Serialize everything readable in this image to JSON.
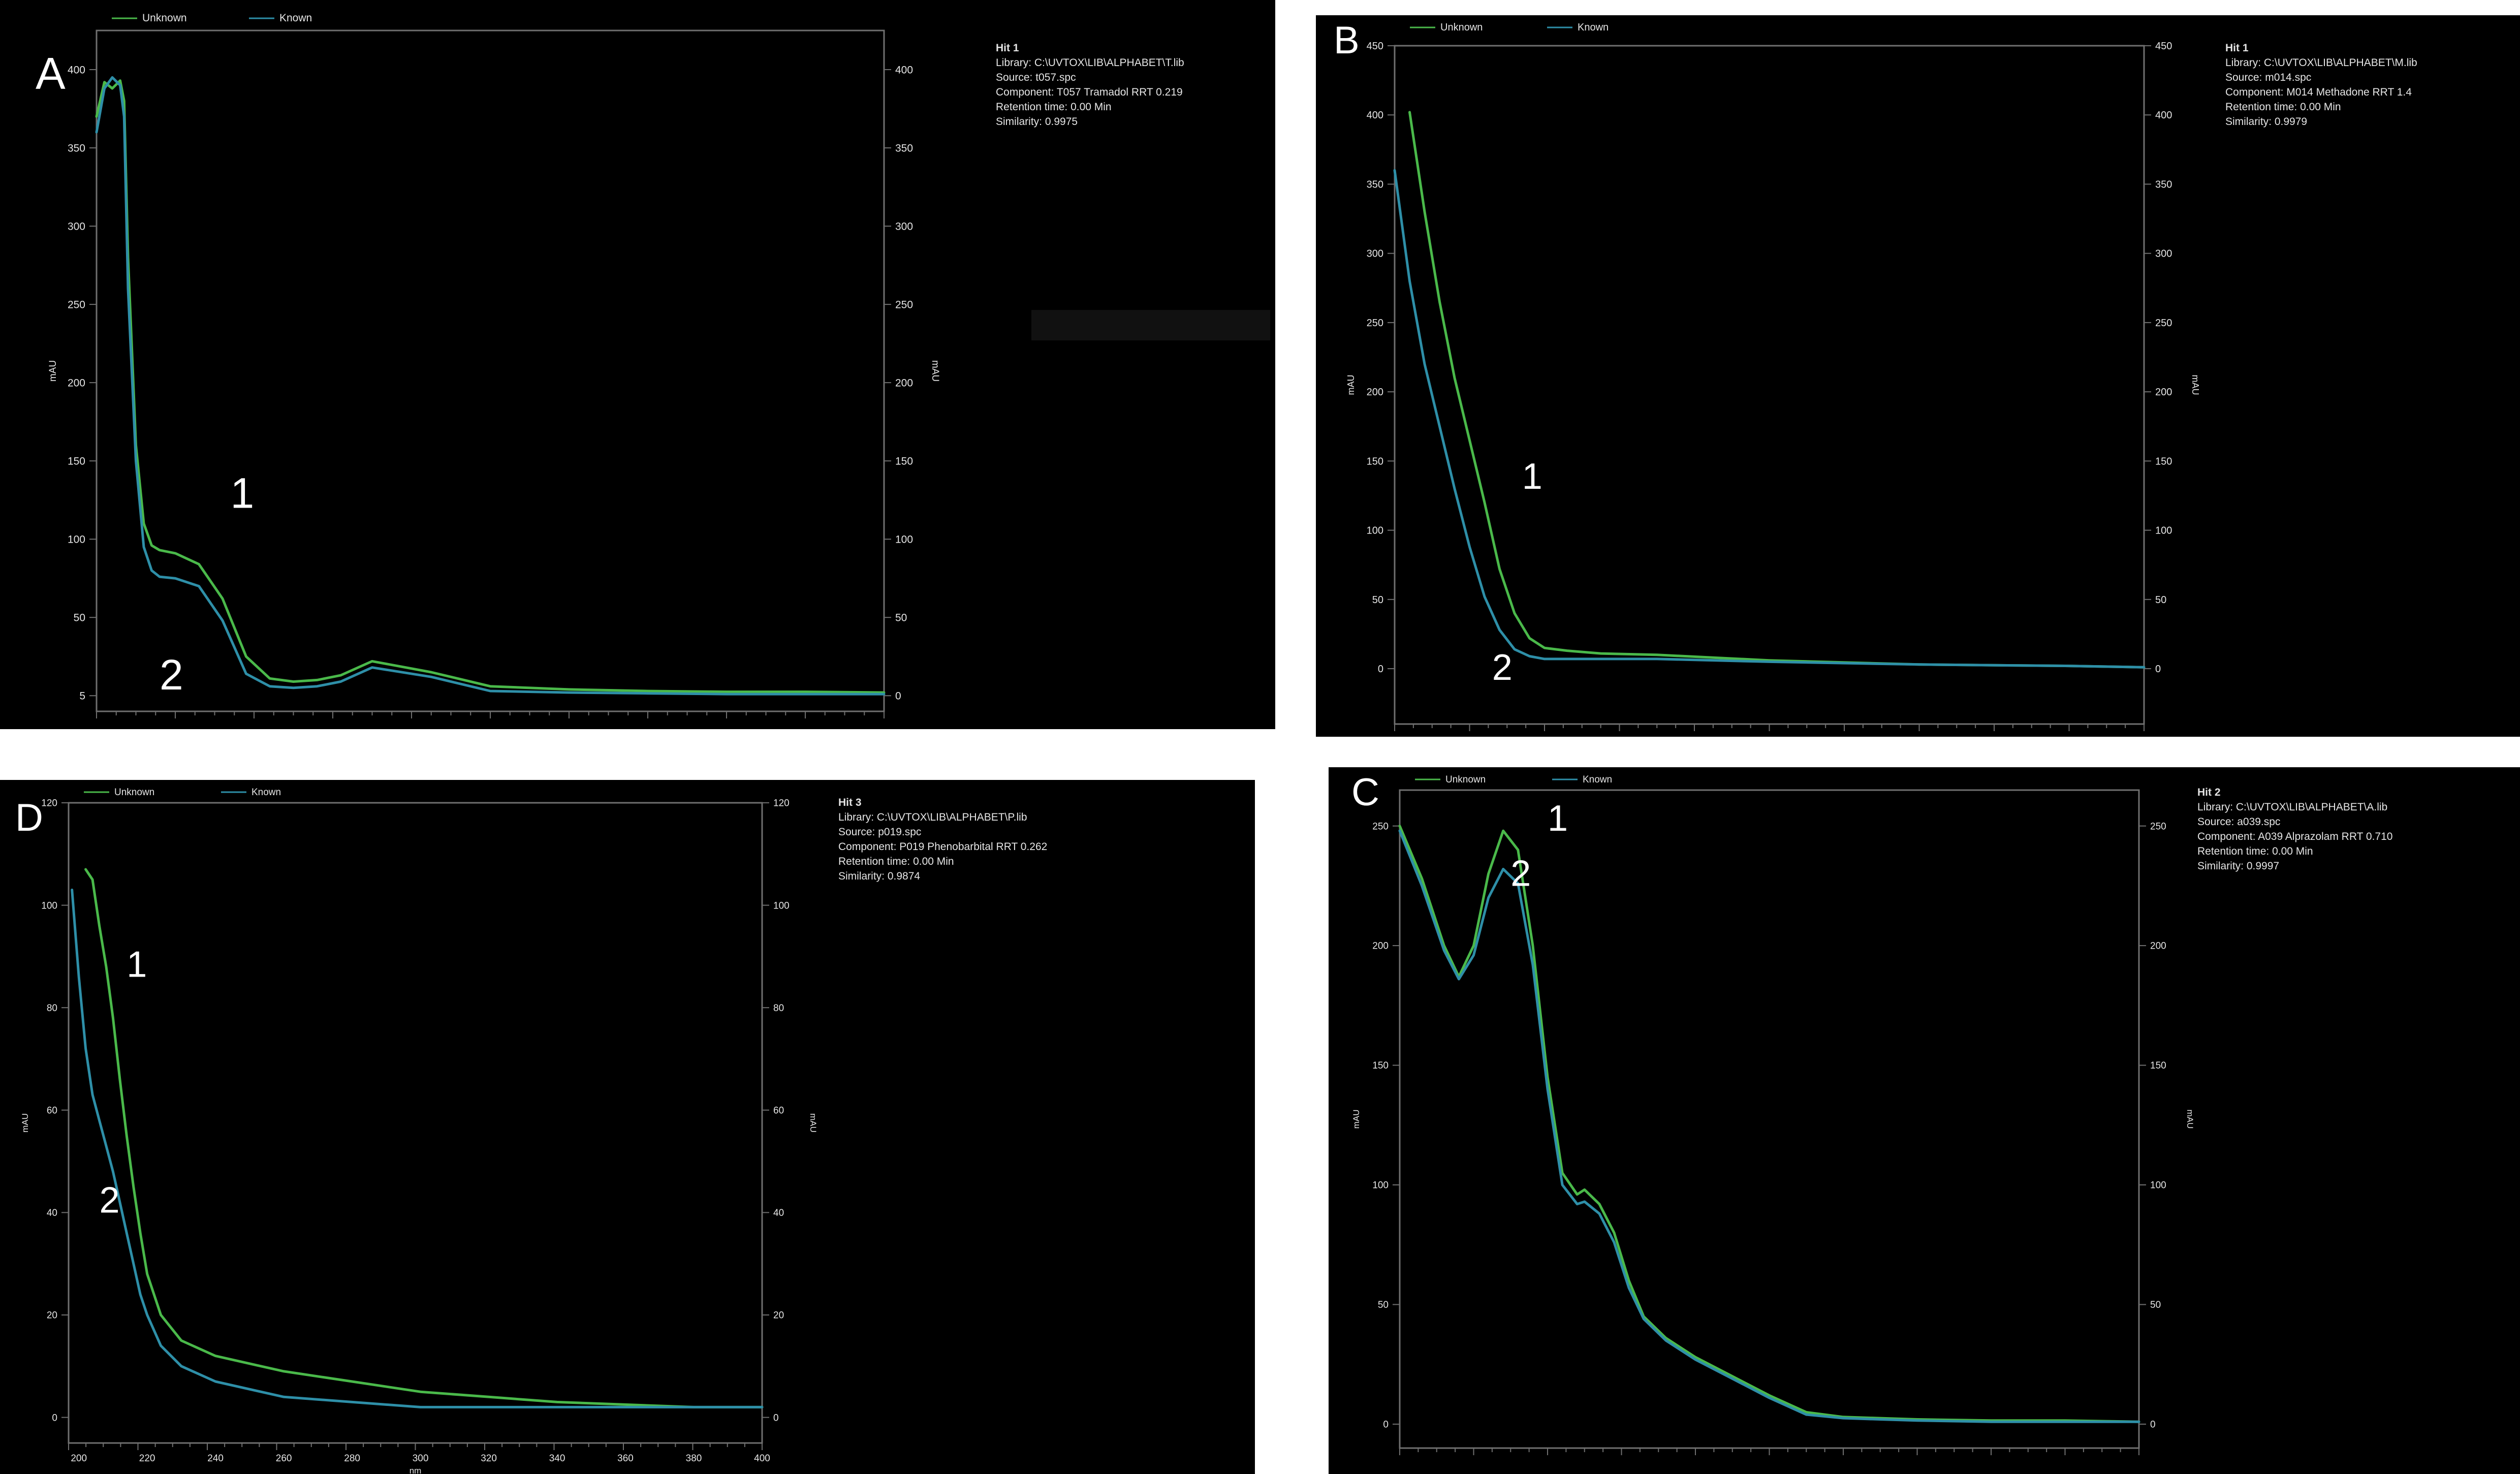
{
  "colors": {
    "background": "#000000",
    "frame": "#6f6f6f",
    "unknown": "#4ab94a",
    "known": "#2e8fa8",
    "text": "#e6e6e6"
  },
  "panels": {
    "A": {
      "letter": "A",
      "info": {
        "hit": "Hit 1",
        "library": "Library: C:\\UVTOX\\LIB\\ALPHABET\\T.lib",
        "source": "Source: t057.spc",
        "component": "Component: T057  Tramadol  RRT 0.219",
        "retention": "Retention time: 0.00 Min",
        "similarity": "Similarity: 0.9975"
      }
    },
    "B": {
      "letter": "B",
      "info": {
        "hit": "Hit 1",
        "library": "Library: C:\\UVTOX\\LIB\\ALPHABET\\M.lib",
        "source": "Source: m014.spc",
        "component": "Component: M014  Methadone  RRT 1.4",
        "retention": "Retention time: 0.00 Min",
        "similarity": "Similarity: 0.9979"
      }
    },
    "D": {
      "letter": "D",
      "info": {
        "hit": "Hit 3",
        "library": "Library: C:\\UVTOX\\LIB\\ALPHABET\\P.lib",
        "source": "Source: p019.spc",
        "component": "Component: P019  Phenobarbital  RRT 0.262",
        "retention": "Retention time: 0.00 Min",
        "similarity": "Similarity: 0.9874"
      }
    },
    "C": {
      "letter": "C",
      "info": {
        "hit": "Hit 2",
        "library": "Library: C:\\UVTOX\\LIB\\ALPHABET\\A.lib",
        "source": "Source: a039.spc",
        "component": "Component: A039  Alprazolam  RRT 0.710",
        "retention": "Retention time: 0.00 Min",
        "similarity": "Similarity: 0.9997"
      }
    }
  },
  "chart_data": [
    {
      "id": "A",
      "type": "line",
      "legend": [
        "Unknown",
        "Known"
      ],
      "legend_position": "top-left",
      "ylabel": "mAU",
      "y2label": "mAU",
      "xlim": [
        200,
        400
      ],
      "ylim": [
        -10,
        425
      ],
      "yticks": [
        0,
        50,
        100,
        150,
        200,
        250,
        300,
        350,
        400
      ],
      "ytick_labels": [
        "5",
        "50",
        "100",
        "150",
        "200",
        "250",
        "300",
        "350",
        "400"
      ],
      "y2tick_labels": [
        "0",
        "50",
        "100",
        "150",
        "200",
        "250",
        "300",
        "350",
        "400"
      ],
      "annotations": [
        {
          "text": "1",
          "x": 234,
          "y": 120
        },
        {
          "text": "2",
          "x": 216,
          "y": 4
        }
      ],
      "series": [
        {
          "name": "Unknown",
          "x": [
            200,
            202,
            204,
            206,
            207,
            208,
            210,
            212,
            214,
            216,
            220,
            226,
            232,
            238,
            244,
            250,
            256,
            262,
            270,
            285,
            300,
            320,
            340,
            360,
            380,
            400
          ],
          "y": [
            370,
            392,
            388,
            393,
            380,
            280,
            160,
            110,
            96,
            93,
            91,
            84,
            62,
            25,
            11,
            9,
            10,
            13,
            22,
            15,
            6,
            4,
            3,
            2.5,
            2.5,
            2
          ]
        },
        {
          "name": "Known",
          "x": [
            200,
            202,
            204,
            206,
            207,
            208,
            210,
            212,
            214,
            216,
            220,
            226,
            232,
            238,
            244,
            250,
            256,
            262,
            270,
            285,
            300,
            320,
            340,
            360,
            380,
            400
          ],
          "y": [
            360,
            388,
            395,
            390,
            370,
            260,
            150,
            95,
            80,
            76,
            75,
            70,
            48,
            14,
            6,
            5,
            6,
            9,
            18,
            12,
            3,
            2,
            1.5,
            1,
            1,
            1
          ]
        }
      ]
    },
    {
      "id": "B",
      "type": "line",
      "legend": [
        "Unknown",
        "Known"
      ],
      "legend_position": "top-left",
      "ylabel": "mAU",
      "y2label": "mAU",
      "xlim": [
        200,
        400
      ],
      "ylim": [
        -40,
        450
      ],
      "yticks": [
        0,
        50,
        100,
        150,
        200,
        250,
        300,
        350,
        400,
        450
      ],
      "ytick_labels": [
        "0",
        "50",
        "100",
        "150",
        "200",
        "250",
        "300",
        "350",
        "400",
        "450"
      ],
      "y2tick_labels": [
        "0",
        "50",
        "100",
        "150",
        "200",
        "250",
        "300",
        "350",
        "400",
        "450"
      ],
      "annotations": [
        {
          "text": "1",
          "x": 234,
          "y": 130
        },
        {
          "text": "2",
          "x": 226,
          "y": -8
        }
      ],
      "series": [
        {
          "name": "Unknown",
          "x": [
            204,
            208,
            212,
            216,
            220,
            224,
            228,
            232,
            236,
            240,
            246,
            255,
            270,
            300,
            340,
            380,
            400
          ],
          "y": [
            402,
            330,
            265,
            210,
            165,
            120,
            72,
            40,
            22,
            15,
            13,
            11,
            10,
            6,
            3,
            2,
            1
          ]
        },
        {
          "name": "Known",
          "x": [
            200,
            204,
            208,
            212,
            216,
            220,
            224,
            228,
            232,
            236,
            240,
            246,
            255,
            270,
            300,
            340,
            380,
            400
          ],
          "y": [
            360,
            280,
            220,
            175,
            130,
            88,
            52,
            28,
            14,
            9,
            7,
            7,
            7,
            7,
            5,
            3,
            2,
            1
          ]
        }
      ]
    },
    {
      "id": "D",
      "type": "line",
      "legend": [
        "Unknown",
        "Known"
      ],
      "legend_position": "top-left",
      "xlabel": "nm",
      "ylabel": "mAU",
      "y2label": "mAU",
      "xlim": [
        197,
        400
      ],
      "ylim": [
        -5,
        120
      ],
      "xticks": [
        200,
        220,
        240,
        260,
        280,
        300,
        320,
        340,
        360,
        380,
        400
      ],
      "yticks": [
        0,
        20,
        40,
        60,
        80,
        100,
        120
      ],
      "annotations": [
        {
          "text": "1",
          "x": 214,
          "y": 86
        },
        {
          "text": "2",
          "x": 206,
          "y": 40
        }
      ],
      "series": [
        {
          "name": "Unknown",
          "x": [
            202,
            204,
            206,
            208,
            210,
            212,
            214,
            216,
            218,
            220,
            224,
            230,
            240,
            250,
            260,
            280,
            300,
            320,
            340,
            360,
            380,
            400
          ],
          "y": [
            107,
            105,
            96,
            88,
            78,
            66,
            55,
            45,
            36,
            28,
            20,
            15,
            12,
            10.5,
            9,
            7,
            5,
            4,
            3,
            2.5,
            2,
            2
          ]
        },
        {
          "name": "Known",
          "x": [
            198,
            200,
            202,
            204,
            206,
            208,
            210,
            212,
            214,
            216,
            218,
            220,
            224,
            230,
            240,
            260,
            280,
            300,
            340,
            380,
            400
          ],
          "y": [
            103,
            86,
            72,
            63,
            58,
            53,
            48,
            42,
            36,
            30,
            24,
            20,
            14,
            10,
            7,
            4,
            3,
            2,
            2,
            2,
            2
          ]
        }
      ]
    },
    {
      "id": "C",
      "type": "line",
      "legend": [
        "Unknown",
        "Known"
      ],
      "legend_position": "top-left",
      "ylabel": "mAU",
      "y2label": "mAU",
      "xlim": [
        200,
        400
      ],
      "ylim": [
        -10,
        265
      ],
      "yticks": [
        0,
        50,
        100,
        150,
        200,
        250
      ],
      "ytick_labels": [
        "0",
        "50",
        "100",
        "150",
        "200",
        "250"
      ],
      "y2tick_labels": [
        "0",
        "50",
        "100",
        "150",
        "200",
        "250"
      ],
      "annotations": [
        {
          "text": "1",
          "x": 240,
          "y": 248
        },
        {
          "text": "2",
          "x": 230,
          "y": 225
        }
      ],
      "series": [
        {
          "name": "Unknown",
          "x": [
            200,
            206,
            212,
            216,
            220,
            224,
            228,
            232,
            236,
            240,
            244,
            248,
            250,
            254,
            258,
            262,
            266,
            272,
            280,
            290,
            300,
            310,
            320,
            330,
            340,
            360,
            380,
            400
          ],
          "y": [
            250,
            228,
            200,
            187,
            200,
            230,
            248,
            240,
            200,
            145,
            105,
            96,
            98,
            92,
            80,
            60,
            45,
            36,
            28,
            20,
            12,
            5,
            3,
            2.5,
            2,
            1.5,
            1.5,
            1
          ]
        },
        {
          "name": "Known",
          "x": [
            200,
            206,
            212,
            216,
            220,
            224,
            228,
            232,
            236,
            240,
            244,
            248,
            250,
            254,
            258,
            262,
            266,
            272,
            280,
            290,
            300,
            310,
            320,
            330,
            340,
            360,
            380,
            400
          ],
          "y": [
            248,
            225,
            198,
            186,
            196,
            220,
            232,
            226,
            192,
            140,
            100,
            92,
            93,
            88,
            76,
            57,
            44,
            35,
            27,
            19,
            11,
            4,
            2.5,
            2,
            1.5,
            1,
            1,
            1
          ]
        }
      ]
    }
  ]
}
